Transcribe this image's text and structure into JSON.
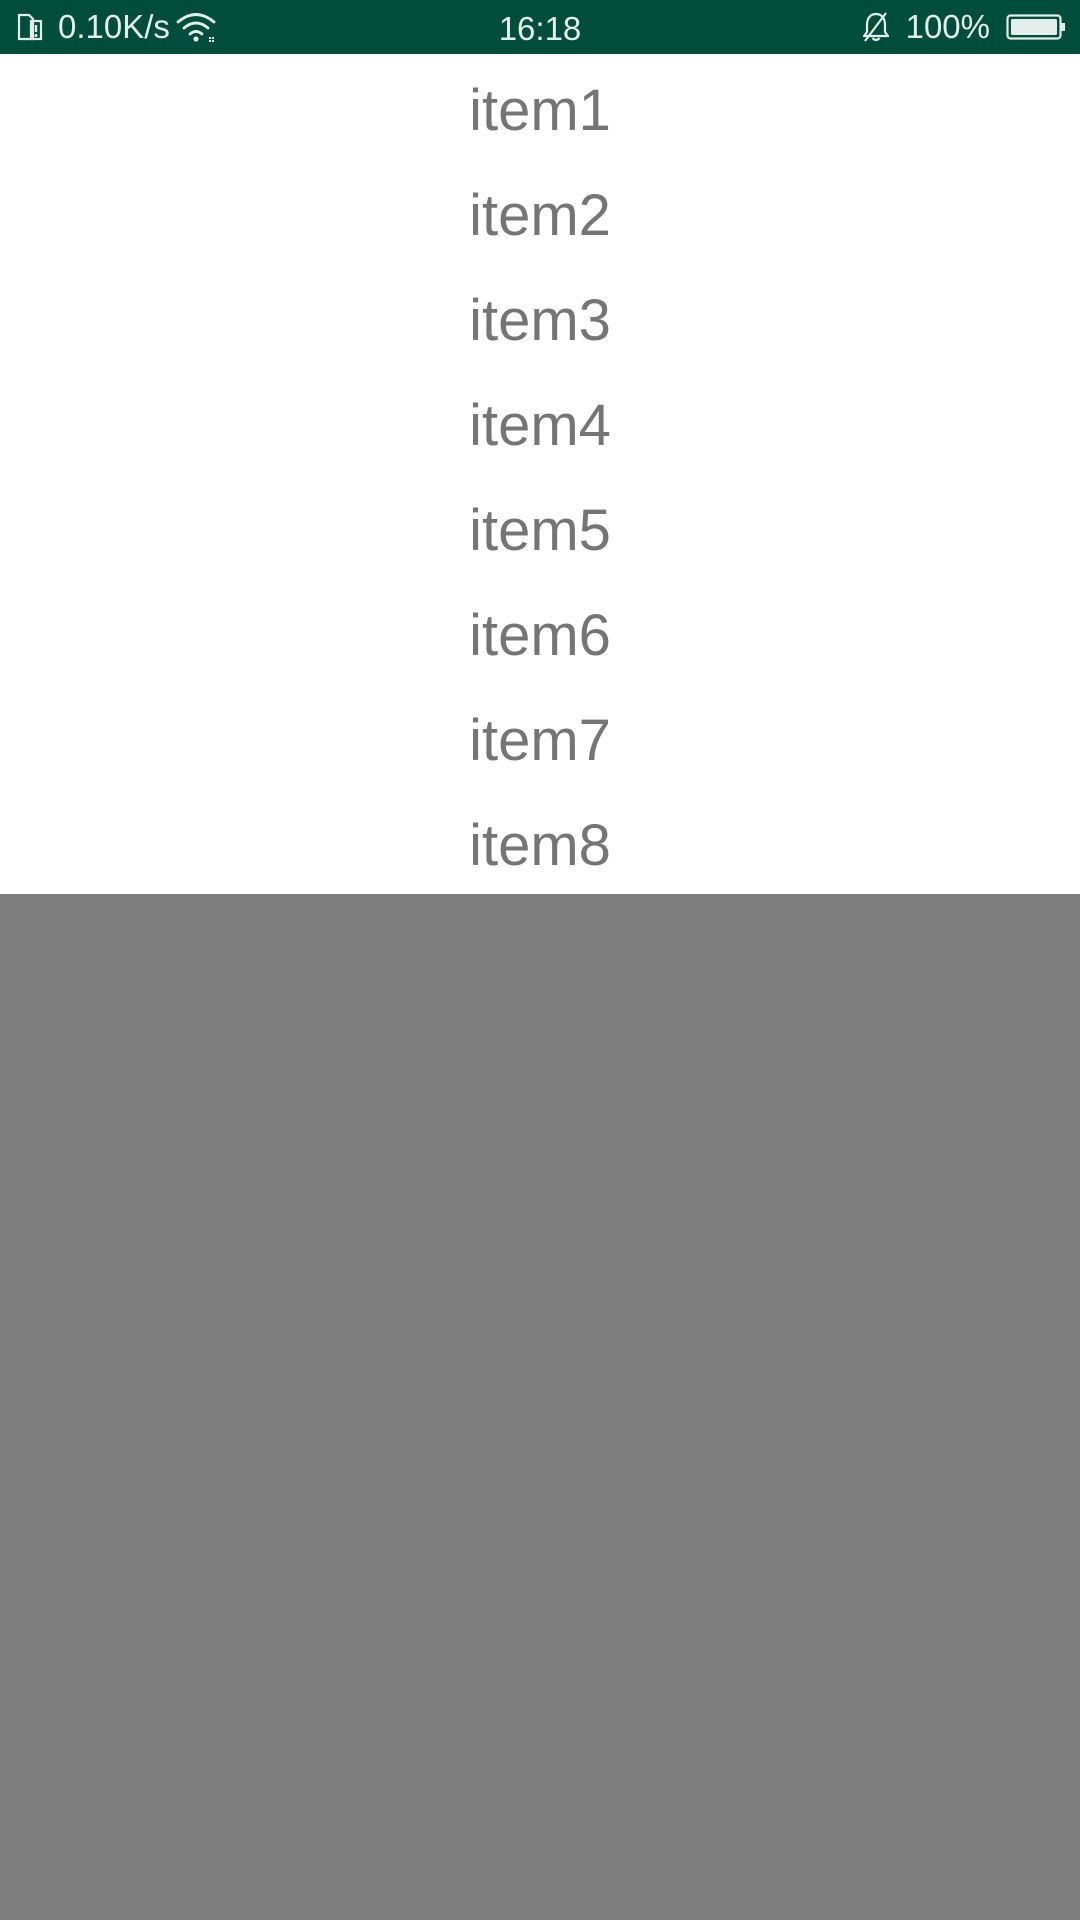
{
  "status_bar": {
    "network_speed": "0.10K/s",
    "time": "16:18",
    "battery_percent": "100%",
    "background_color": "#004d3b",
    "icons": [
      "sim-card-icon",
      "wifi-icon",
      "bell-muted-icon",
      "battery-icon"
    ]
  },
  "list": {
    "items": [
      {
        "label": "item1"
      },
      {
        "label": "item2"
      },
      {
        "label": "item3"
      },
      {
        "label": "item4"
      },
      {
        "label": "item5"
      },
      {
        "label": "item6"
      },
      {
        "label": "item7"
      },
      {
        "label": "item8"
      }
    ]
  },
  "overlay": {
    "color": "#7f7f7f"
  }
}
